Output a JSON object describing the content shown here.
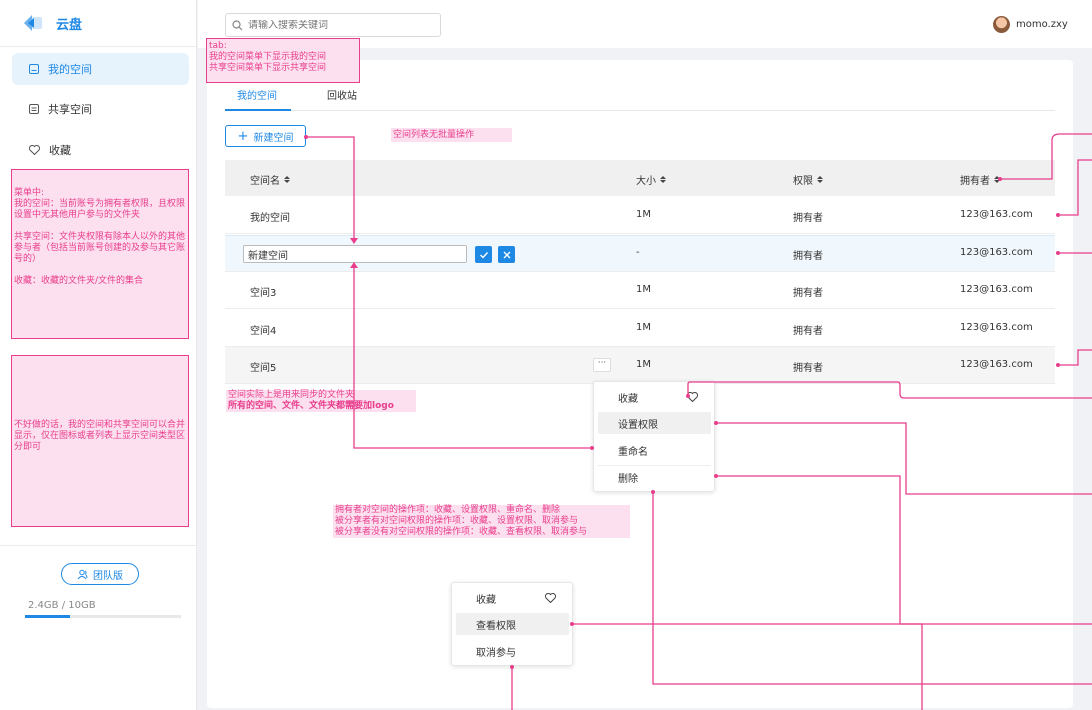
{
  "app": {
    "title": "云盘"
  },
  "sidebar": {
    "items": [
      {
        "label": "我的空间",
        "icon": "folder-icon",
        "active": true
      },
      {
        "label": "共享空间",
        "icon": "share-folder-icon",
        "active": false
      },
      {
        "label": "收藏",
        "icon": "heart-icon",
        "active": false
      }
    ],
    "team_label": "团队版",
    "storage_text": "2.4GB / 10GB",
    "storage_used_fraction": 0.29
  },
  "header": {
    "search_placeholder": "请输入搜索关键词",
    "username": "momo.zxy"
  },
  "tabs": [
    {
      "label": "我的空间",
      "active": true
    },
    {
      "label": "回收站",
      "active": false
    }
  ],
  "toolbar": {
    "new_label": "新建空间"
  },
  "table": {
    "columns": [
      "空间名",
      "大小",
      "权限",
      "拥有者"
    ],
    "rows": [
      {
        "name": "我的空间",
        "size": "1M",
        "perm": "拥有者",
        "owner": "123@163.com"
      },
      {
        "name": "",
        "edit_value": "新建空间",
        "size": "-",
        "perm": "拥有者",
        "owner": "123@163.com"
      },
      {
        "name": "空间3",
        "size": "1M",
        "perm": "拥有者",
        "owner": "123@163.com"
      },
      {
        "name": "空间4",
        "size": "1M",
        "perm": "拥有者",
        "owner": "123@163.com"
      },
      {
        "name": "空间5",
        "size": "1M",
        "perm": "拥有者",
        "owner": "123@163.com"
      }
    ],
    "more_label": "···"
  },
  "owner_menu": {
    "items": [
      "收藏",
      "设置权限",
      "重命名",
      "删除"
    ]
  },
  "viewer_menu": {
    "items": [
      "收藏",
      "查看权限",
      "取消参与"
    ]
  },
  "annotations": {
    "tab_note": [
      "tab:",
      "我的空间菜单下显示我的空间",
      "共享空间菜单下显示共享空间"
    ],
    "list_note": "空间列表无批量操作",
    "menu_note": [
      "菜单中:",
      "我的空间：当前账号为拥有者权限，且权限设置中无其他用户参与的文件夹",
      "",
      "共享空间：文件夹权限有除本人以外的其他参与者（包括当前账号创建的及参与其它账号的）",
      "",
      "收藏：收藏的文件夹/文件的集合"
    ],
    "merge_note": "不好做的话，我的空间和共享空间可以合并显示，仅在图标或者列表上显示空间类型区分即可",
    "sync_note": [
      "空间实际上是用来同步的文件夹",
      "所有的空间、文件、文件夹都需要加logo"
    ],
    "ops_note": [
      "拥有者对空间的操作项：收藏、设置权限、重命名、删除",
      "被分享者有对空间权限的操作项：收藏、设置权限、取消参与",
      "被分享者没有对空间权限的操作项：收藏、查看权限、取消参与"
    ]
  },
  "colors": {
    "accent": "#1e88e5",
    "annotation": "#e83e8c",
    "annotation_bg": "#fde0ef"
  }
}
